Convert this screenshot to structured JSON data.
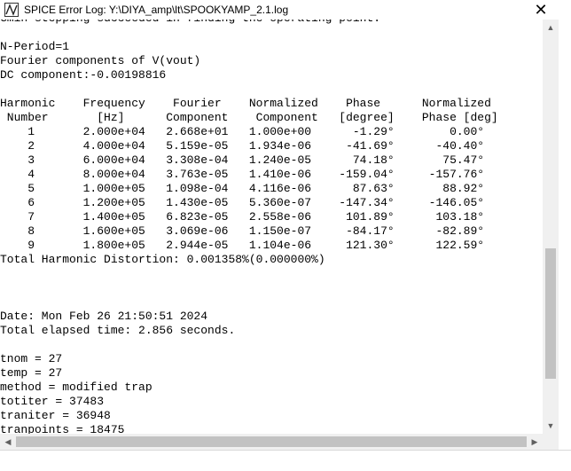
{
  "window": {
    "title": "SPICE Error Log: Y:\\DIYA_amp\\lt\\SPOOKYAMP_2.1.log",
    "close_glyph": "✕"
  },
  "log_lines": [
    "Gmin stepping succeeded in finding the operating point.",
    "",
    "N-Period=1",
    "Fourier components of V(vout)",
    "DC component:-0.00198816",
    "",
    "Harmonic    Frequency    Fourier    Normalized    Phase      Normalized",
    " Number       [Hz]      Component    Component   [degree]    Phase [deg]",
    "    1       2.000e+04   2.668e+01   1.000e+00      -1.29°        0.00°",
    "    2       4.000e+04   5.159e-05   1.934e-06     -41.69°      -40.40°",
    "    3       6.000e+04   3.308e-04   1.240e-05      74.18°       75.47°",
    "    4       8.000e+04   3.763e-05   1.410e-06    -159.04°     -157.76°",
    "    5       1.000e+05   1.098e-04   4.116e-06      87.63°       88.92°",
    "    6       1.200e+05   1.430e-05   5.360e-07    -147.34°     -146.05°",
    "    7       1.400e+05   6.823e-05   2.558e-06     101.89°      103.18°",
    "    8       1.600e+05   3.069e-06   1.150e-07     -84.17°      -82.89°",
    "    9       1.800e+05   2.944e-05   1.104e-06     121.30°      122.59°",
    "Total Harmonic Distortion: 0.001358%(0.000000%)",
    "",
    "",
    "",
    "Date: Mon Feb 26 21:50:51 2024",
    "Total elapsed time: 2.856 seconds.",
    "",
    "tnom = 27",
    "temp = 27",
    "method = modified trap",
    "totiter = 37483",
    "traniter = 36948",
    "tranpoints = 18475"
  ],
  "colors": {
    "scrollbar_track": "#f0f0f0",
    "scrollbar_thumb": "#c2c2c2",
    "icon_accent": "#d4a017"
  },
  "icons": {
    "app": "ltspice-icon",
    "up": "▲",
    "down": "▼",
    "left": "◀",
    "right": "▶"
  }
}
